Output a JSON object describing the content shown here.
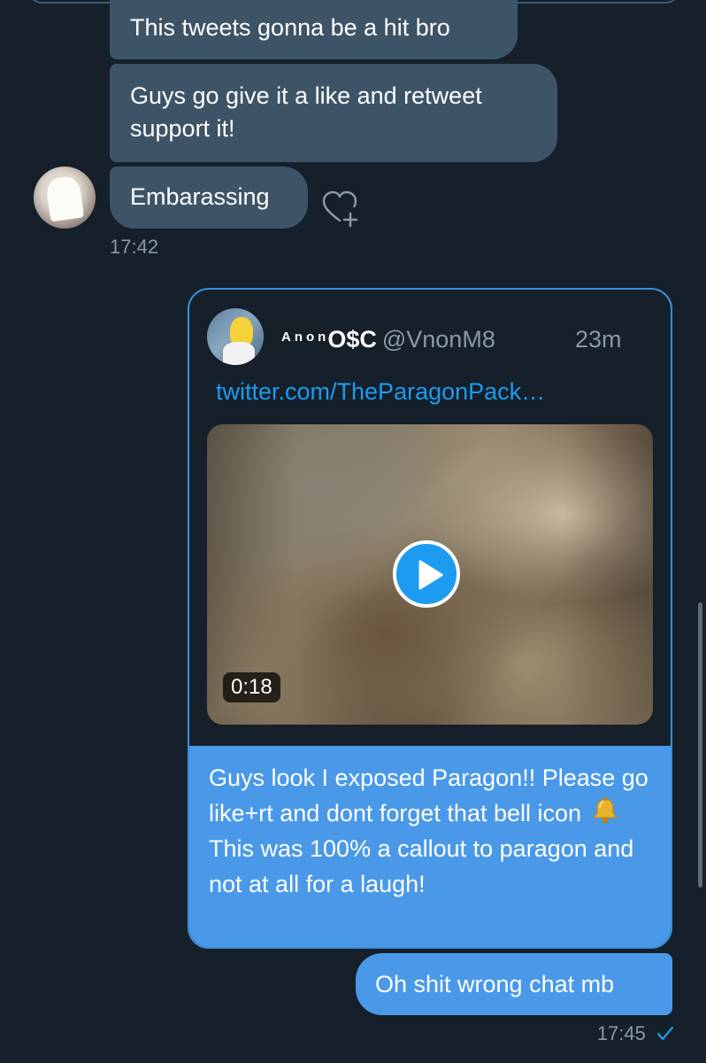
{
  "conversation": {
    "incoming": [
      {
        "text": "This tweets gonna be a hit bro"
      },
      {
        "text": "Guys go give it a like and retweet support it!"
      },
      {
        "text": "Embarassing"
      }
    ],
    "incoming_time": "17:42",
    "shared_tweet": {
      "display_name_prefix": "Anon",
      "display_name": "O$C",
      "handle": "@VnonM8",
      "time_ago": "23m",
      "link": "twitter.com/TheParagonPack…",
      "video_duration": "0:18",
      "text_before_icon": "Guys look I exposed Paragon!! Please go like+rt and dont forget that bell icon",
      "text_after_icon": "This was 100% a callout to paragon and not at all for a laugh!"
    },
    "outgoing": [
      {
        "text": "Oh shit wrong chat mb"
      }
    ],
    "outgoing_time": "17:45"
  },
  "icons": {
    "react": "heart-plus-icon",
    "play": "play-icon",
    "bell": "bell-icon",
    "sent": "check-icon"
  },
  "colors": {
    "background": "#15202b",
    "incoming_bubble": "#3d5466",
    "outgoing_bubble": "#4a99e9",
    "accent": "#1d9bf0",
    "muted_text": "#8899a6"
  }
}
